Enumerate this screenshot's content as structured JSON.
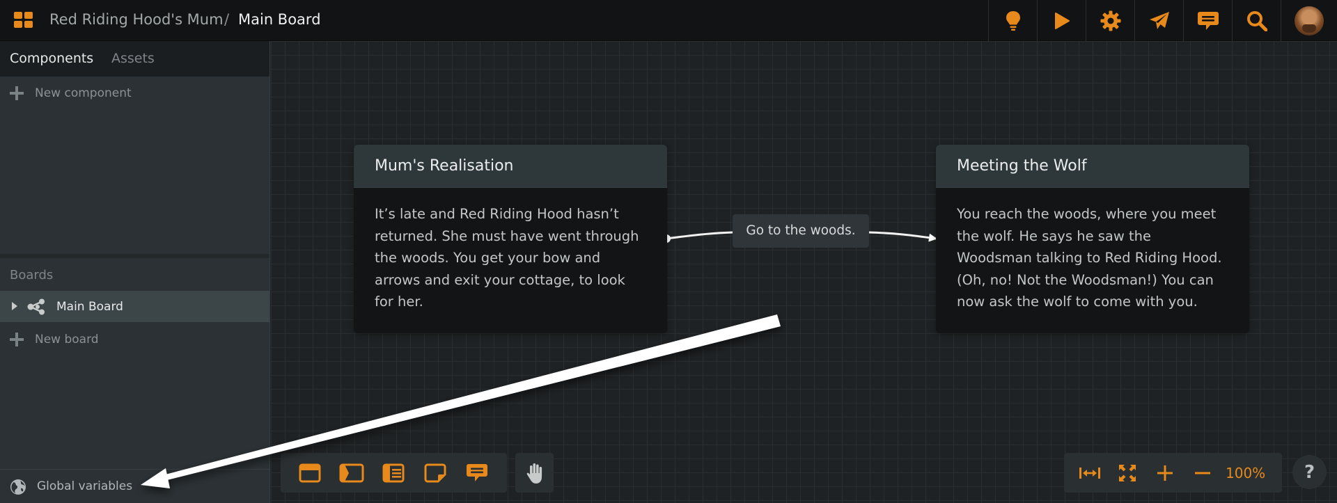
{
  "header": {
    "project_name": "Red Riding Hood's Mum",
    "separator": "/",
    "board_name": "Main Board",
    "actions": [
      {
        "icon": "lightbulb-icon"
      },
      {
        "icon": "play-icon"
      },
      {
        "icon": "gear-icon"
      },
      {
        "icon": "send-icon"
      },
      {
        "icon": "comment-icon"
      },
      {
        "icon": "search-icon"
      }
    ],
    "accent_color": "#e8891c"
  },
  "sidebar": {
    "tabs": [
      {
        "label": "Components",
        "active": true
      },
      {
        "label": "Assets",
        "active": false
      }
    ],
    "new_component_label": "New component",
    "boards_header": "Boards",
    "boards": [
      {
        "label": "Main Board",
        "selected": true
      }
    ],
    "new_board_label": "New board",
    "global_variables_label": "Global variables"
  },
  "canvas": {
    "nodes": [
      {
        "title": "Mum's Realisation",
        "body": "It’s late and Red Riding Hood hasn’t returned. She must have went through the woods. You get your bow and arrows and exit your cottage, to look for her."
      },
      {
        "title": "Meeting the Wolf",
        "body": "You reach the woods, where you meet the wolf. He says he saw the Woodsman talking to Red Riding Hood. (Oh, no! Not the Woodsman!) You can now ask the wolf to come with you."
      }
    ],
    "connection_label": "Go to the woods.",
    "tools": [
      {
        "icon": "card-icon"
      },
      {
        "icon": "jump-icon"
      },
      {
        "icon": "list-card-icon"
      },
      {
        "icon": "note-icon"
      },
      {
        "icon": "comment-tool-icon"
      }
    ],
    "hand_tool_icon": "hand-icon",
    "zoom": {
      "fit_width_icon": "fit-width-icon",
      "fit_screen_icon": "fit-screen-icon",
      "zoom_in_icon": "plus-icon",
      "zoom_out_icon": "minus-icon",
      "level": "100%"
    },
    "help_label": "?"
  }
}
